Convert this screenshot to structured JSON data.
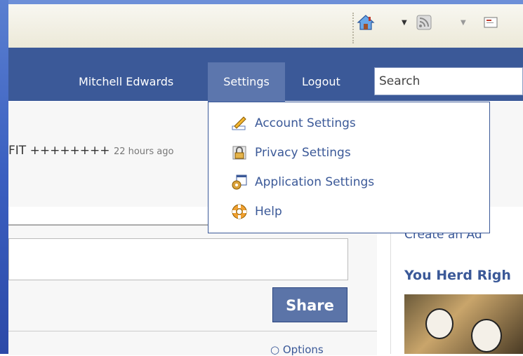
{
  "browser": {
    "toolbar_icons": [
      "home-icon",
      "feeds-icon",
      "mail-icon"
    ]
  },
  "header": {
    "user_name": "Mitchell Edwards",
    "settings_label": "Settings",
    "logout_label": "Logout",
    "search_placeholder": "Search",
    "colors": {
      "bar": "#3b5998",
      "active": "#5c76ad"
    }
  },
  "settings_menu": {
    "items": [
      {
        "label": "Account Settings",
        "icon": "pencil-ruler-icon"
      },
      {
        "label": "Privacy Settings",
        "icon": "lock-icon"
      },
      {
        "label": "Application Settings",
        "icon": "application-gear-icon"
      },
      {
        "label": "Help",
        "icon": "lifebuoy-icon"
      }
    ]
  },
  "feed": {
    "status_text": "FIT ++++++++ ",
    "status_time": "22 hours ago",
    "share_label": "Share",
    "options_label": "Options"
  },
  "sidebar": {
    "create_ad_label": "Create an Ad",
    "ad_title": "You Herd Righ"
  }
}
